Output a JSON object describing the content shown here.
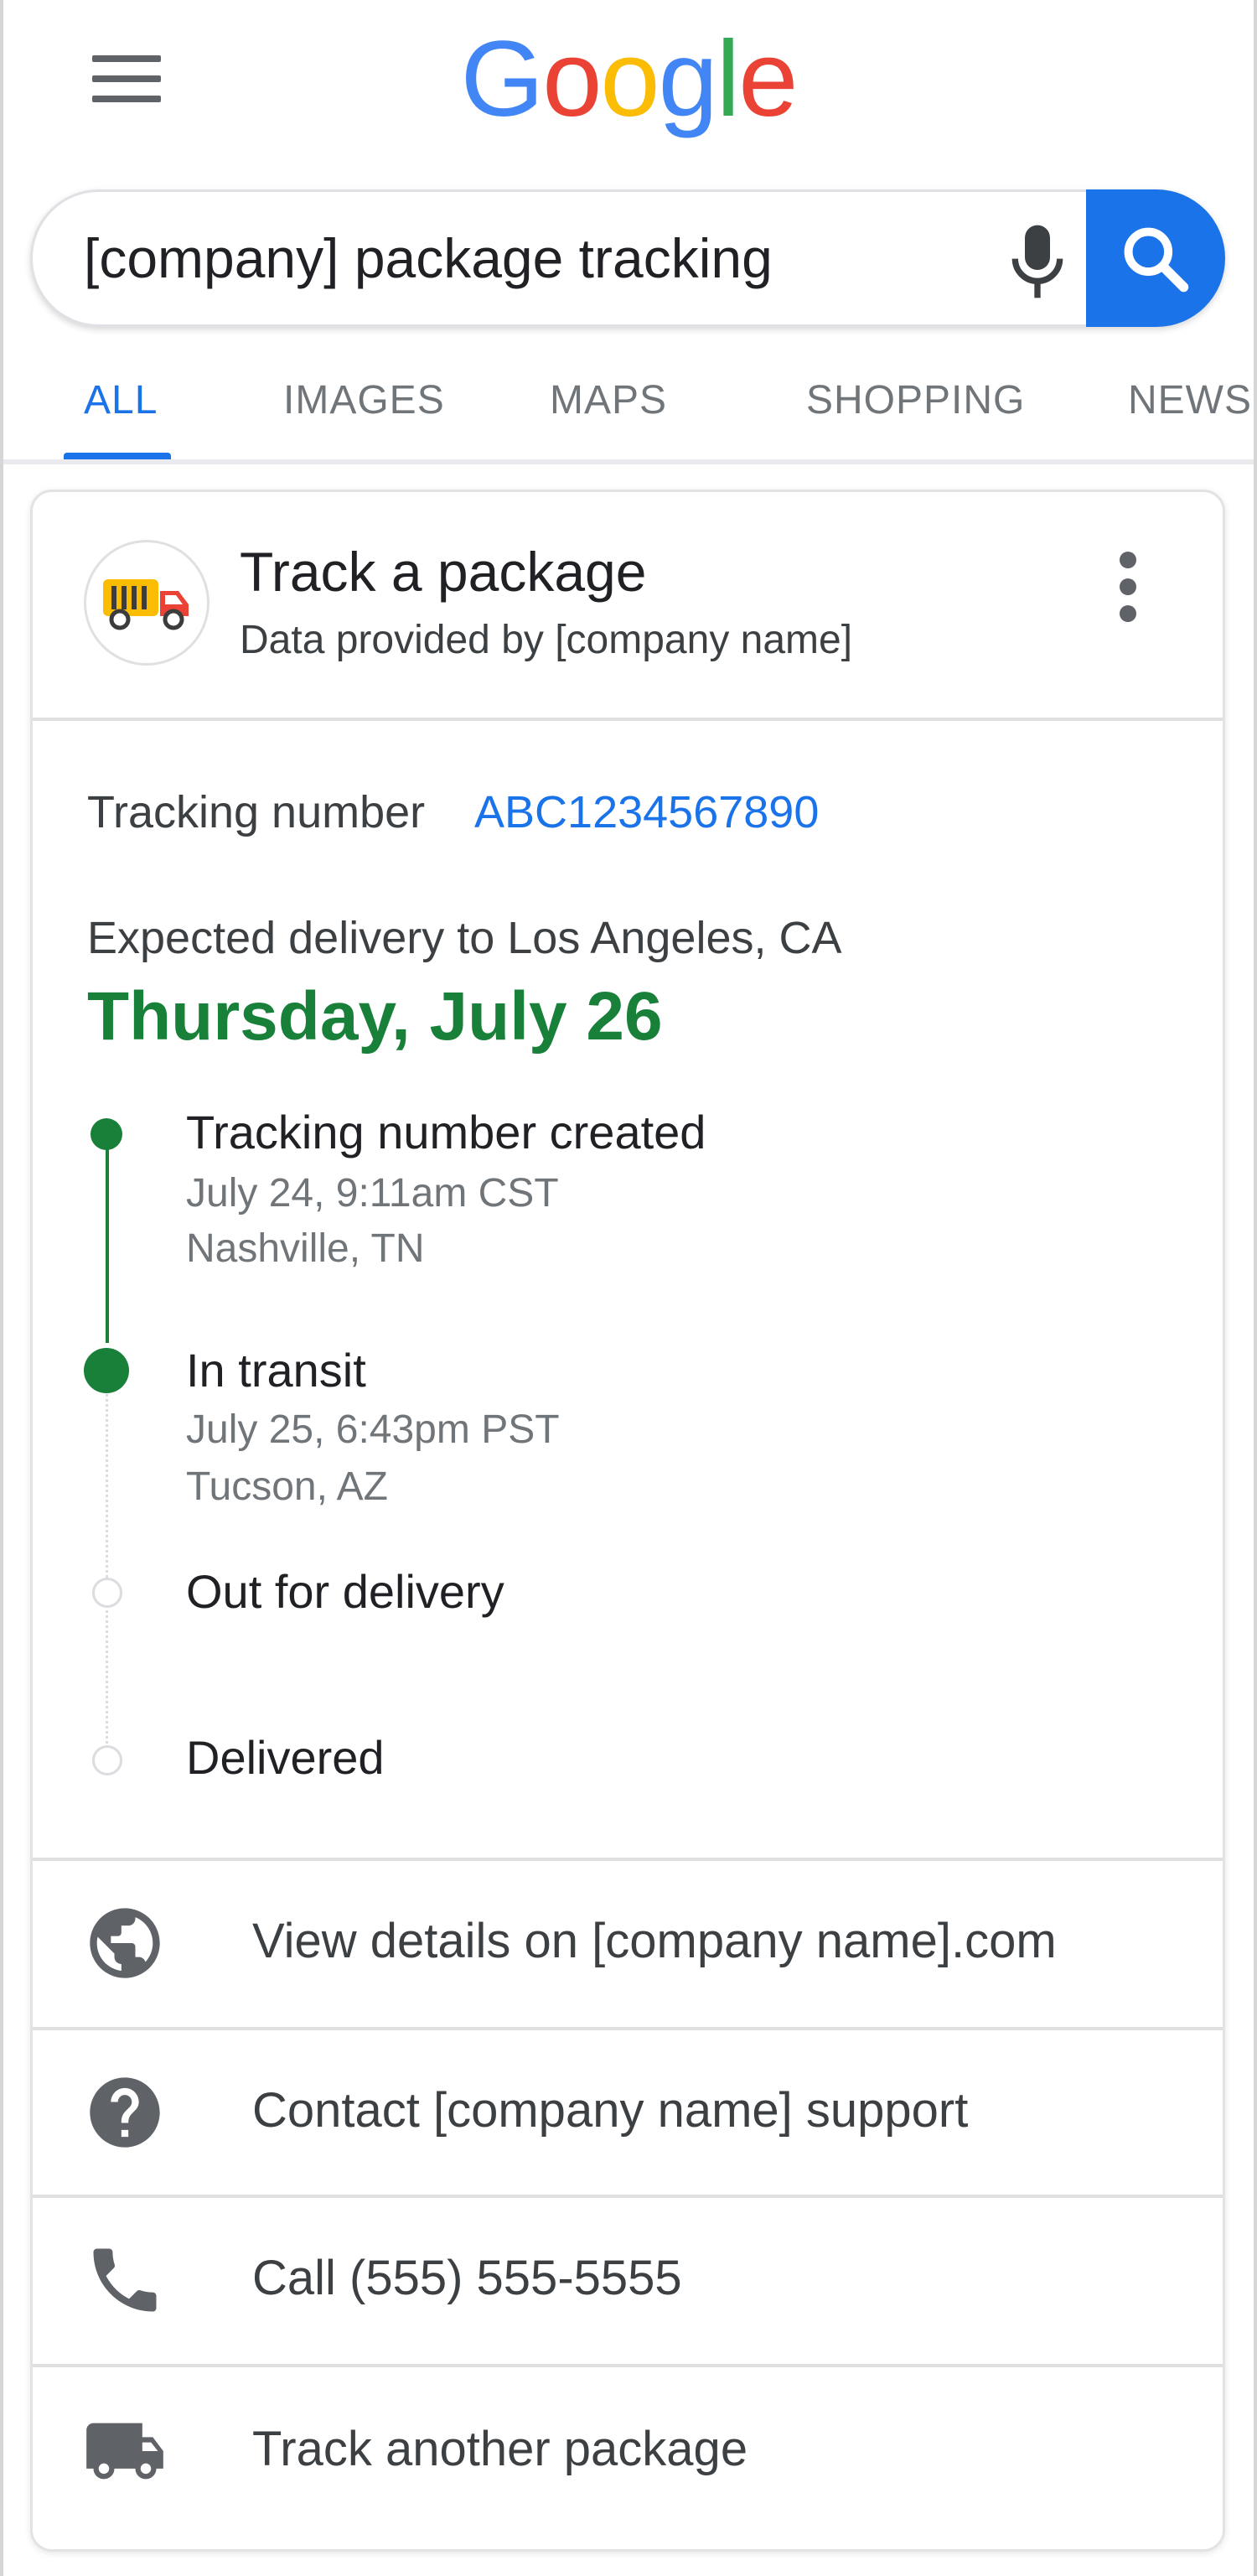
{
  "header": {
    "logo_letters": [
      {
        "char": "G",
        "color": "#4285F4"
      },
      {
        "char": "o",
        "color": "#EA4335"
      },
      {
        "char": "o",
        "color": "#FBBC05"
      },
      {
        "char": "g",
        "color": "#4285F4"
      },
      {
        "char": "l",
        "color": "#34A853"
      },
      {
        "char": "e",
        "color": "#EA4335"
      }
    ],
    "menu_icon": "hamburger-menu-icon"
  },
  "search": {
    "query": "[company] package tracking",
    "mic_icon": "microphone-icon",
    "search_icon": "magnifier-icon"
  },
  "tabs": [
    {
      "label": "ALL",
      "active": true
    },
    {
      "label": "IMAGES",
      "active": false
    },
    {
      "label": "MAPS",
      "active": false
    },
    {
      "label": "SHOPPING",
      "active": false
    },
    {
      "label": "NEWS",
      "active": false
    }
  ],
  "card": {
    "title": "Track a package",
    "subtitle": "Data provided by [company name]",
    "brand_icon": "delivery-truck-icon",
    "more_icon": "more-vertical-icon",
    "tracking": {
      "label": "Tracking number",
      "number": "ABC1234567890"
    },
    "expected": {
      "label": "Expected delivery to Los Angeles, CA",
      "date": "Thursday, July 26"
    },
    "timeline": [
      {
        "title": "Tracking number created",
        "time": "July 24, 9:11am CST",
        "location": "Nashville, TN",
        "status": "done"
      },
      {
        "title": "In transit",
        "time": "July 25, 6:43pm PST",
        "location": "Tucson, AZ",
        "status": "current"
      },
      {
        "title": "Out for delivery",
        "status": "pending"
      },
      {
        "title": "Delivered",
        "status": "pending"
      }
    ],
    "actions": [
      {
        "label": "View details on [company name].com",
        "icon": "globe-icon"
      },
      {
        "label": "Contact [company name] support",
        "icon": "help-icon"
      },
      {
        "label": "Call (555) 555-5555",
        "icon": "phone-icon"
      },
      {
        "label": "Track another package",
        "icon": "truck-icon"
      }
    ]
  },
  "colors": {
    "accent_blue": "#1a73e8",
    "delivery_green": "#188038",
    "text_primary": "#202124",
    "text_secondary": "#70757a"
  }
}
